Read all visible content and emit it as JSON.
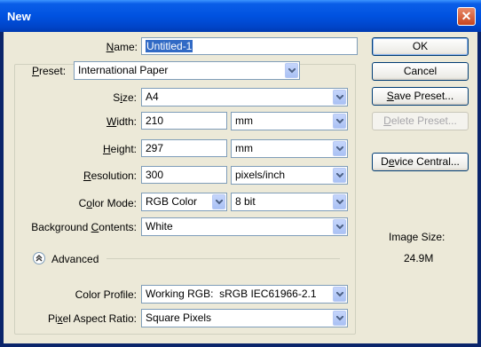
{
  "window": {
    "title": "New",
    "close_glyph": "✕"
  },
  "fields": {
    "name": {
      "label": "Name:",
      "value": "Untitled-1"
    },
    "preset": {
      "label": "Preset:",
      "value": "International Paper"
    },
    "size": {
      "label": "Size:",
      "value": "A4"
    },
    "width": {
      "label": "Width:",
      "value": "210",
      "unit": "mm"
    },
    "height": {
      "label": "Height:",
      "value": "297",
      "unit": "mm"
    },
    "resolution": {
      "label": "Resolution:",
      "value": "300",
      "unit": "pixels/inch"
    },
    "color_mode": {
      "label": "Color Mode:",
      "value": "RGB Color",
      "depth": "8 bit"
    },
    "background": {
      "label": "Background Contents:",
      "value": "White"
    },
    "advanced": {
      "label": "Advanced"
    },
    "color_profile": {
      "label": "Color Profile:",
      "value": "Working RGB:  sRGB IEC61966-2.1"
    },
    "pixel_aspect": {
      "label": "Pixel Aspect Ratio:",
      "value": "Square Pixels"
    }
  },
  "buttons": {
    "ok": "OK",
    "cancel": "Cancel",
    "save_preset": "Save Preset...",
    "delete_preset": "Delete Preset...",
    "device_central": "Device Central..."
  },
  "image_size": {
    "label": "Image Size:",
    "value": "24.9M"
  },
  "icons": {
    "dropdown": "chevron-down-icon",
    "advanced": "double-chevron-up-icon",
    "close": "close-icon"
  }
}
